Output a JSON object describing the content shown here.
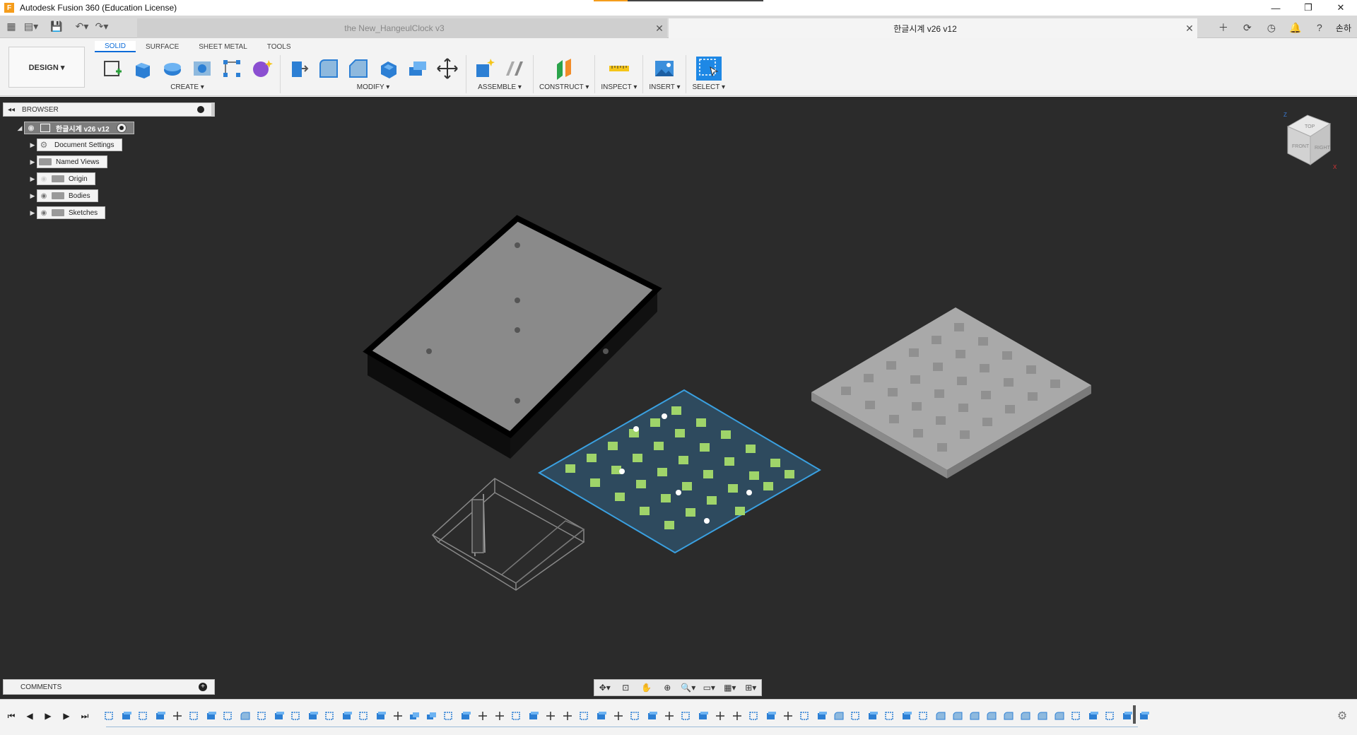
{
  "window": {
    "title": "Autodesk Fusion 360 (Education License)",
    "app_icon_letter": "F",
    "controls": [
      "—",
      "❐",
      "✕"
    ]
  },
  "tabs": {
    "inactive": {
      "label": "the New_HangeulClock v3",
      "close": "✕"
    },
    "active": {
      "label": "한글시계 v26 v12",
      "close": "✕"
    },
    "user": "손하"
  },
  "toolbar": {
    "design_label": "DESIGN ▾",
    "workspace_tabs": [
      "SOLID",
      "SURFACE",
      "SHEET METAL",
      "TOOLS"
    ],
    "groups": {
      "create": "CREATE ▾",
      "modify": "MODIFY ▾",
      "assemble": "ASSEMBLE ▾",
      "construct": "CONSTRUCT ▾",
      "inspect": "INSPECT ▾",
      "insert": "INSERT ▾",
      "select": "SELECT ▾"
    }
  },
  "browser": {
    "title": "BROWSER",
    "root": "한글시계 v26 v12",
    "items": [
      "Document Settings",
      "Named Views",
      "Origin",
      "Bodies",
      "Sketches"
    ]
  },
  "comments": {
    "title": "COMMENTS"
  },
  "viewcube": {
    "faces": [
      "TOP",
      "FRONT",
      "RIGHT"
    ],
    "axes": [
      "Z",
      "X"
    ]
  },
  "colors": {
    "viewport_bg": "#2b2b2b",
    "accent_blue": "#0a6bd8",
    "sketch_green": "#9fd46a",
    "sketch_outline": "#3aa0e0",
    "orange": "#f59d1c"
  }
}
